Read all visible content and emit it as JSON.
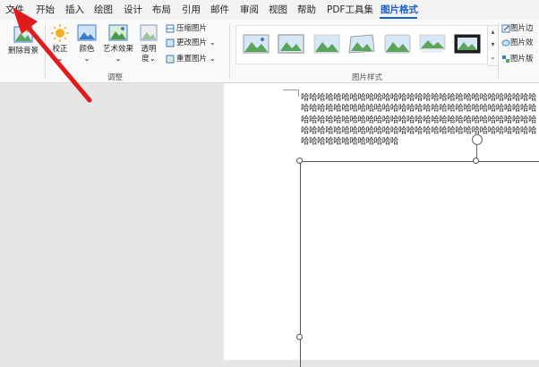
{
  "tabs": [
    "文件",
    "开始",
    "插入",
    "绘图",
    "设计",
    "布局",
    "引用",
    "邮件",
    "审阅",
    "视图",
    "帮助",
    "PDF工具集",
    "图片格式"
  ],
  "ribbon": {
    "remove_bg": "删除背景",
    "correct": "校正",
    "color": "颜色",
    "artistic": "艺术效果",
    "transparency_1": "透明",
    "transparency_2": "度",
    "compress": "压缩图片",
    "change": "更改图片",
    "reset": "重置图片",
    "adjust_group": "调整",
    "styles_group": "图片样式",
    "border": "图片边",
    "effects": "图片效",
    "layout": "图片版"
  },
  "document": {
    "text": "哈哈哈哈哈哈哈哈哈哈哈哈哈哈哈哈哈哈哈哈哈哈哈哈哈哈哈哈哈哈哈哈哈哈哈哈哈哈哈哈哈哈哈哈哈哈哈哈哈哈哈哈哈哈哈哈哈哈哈哈哈哈哈哈哈哈哈哈哈哈哈哈哈哈哈哈哈哈哈哈哈哈哈哈哈哈哈哈哈哈哈哈哈哈哈哈哈哈哈哈哈哈哈哈哈哈哈哈哈哈哈哈哈哈哈哈哈哈哈哈哈哈哈哈哈哈哈哈"
  },
  "colors": {
    "accent": "#1a5ec9",
    "arrow": "#e01b1b"
  }
}
